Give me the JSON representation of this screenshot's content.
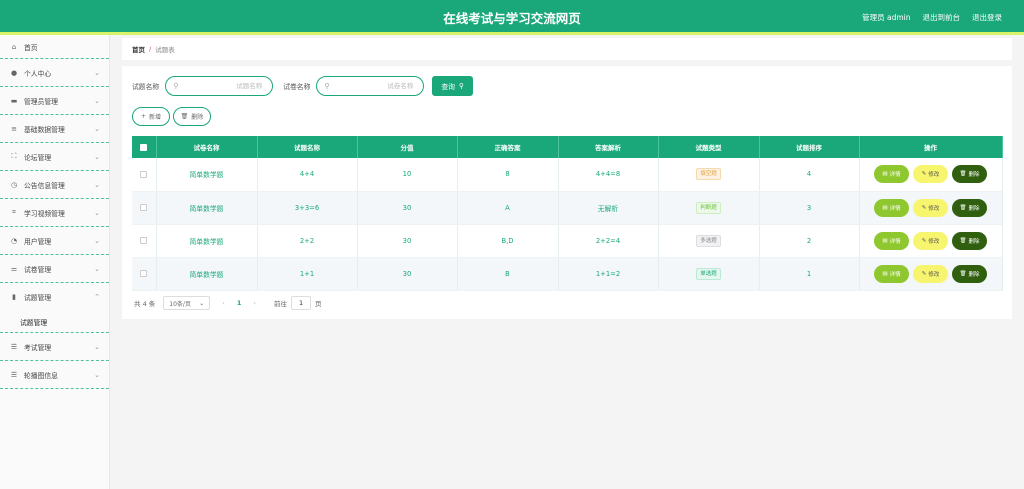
{
  "header": {
    "title": "在线考试与学习交流网页",
    "user_label": "管理员 admin",
    "exit_front": "退出到前台",
    "logout": "退出登录"
  },
  "sidebar": {
    "home": "首页",
    "items": [
      {
        "label": "个人中心",
        "icon": "user-icon"
      },
      {
        "label": "管理员管理",
        "icon": "monitor-icon"
      },
      {
        "label": "基础数据管理",
        "icon": "database-icon"
      },
      {
        "label": "论坛管理",
        "icon": "frame-icon"
      },
      {
        "label": "公告信息管理",
        "icon": "clock-icon"
      },
      {
        "label": "学习视频管理",
        "icon": "crop-icon"
      },
      {
        "label": "用户管理",
        "icon": "dashboard-icon"
      },
      {
        "label": "试卷管理",
        "icon": "sliders-icon"
      },
      {
        "label": "试题管理",
        "icon": "bar-chart-icon"
      }
    ],
    "sub_item": "试题管理",
    "items_after": [
      {
        "label": "考试管理",
        "icon": "list-icon"
      },
      {
        "label": "轮播图信息",
        "icon": "list-icon"
      }
    ]
  },
  "breadcrumb": {
    "home": "首页",
    "separator": "/",
    "current": "试题表"
  },
  "search": {
    "question_label": "试题名称",
    "question_placeholder": "试题名称",
    "paper_label": "试卷名称",
    "paper_placeholder": "试卷名称",
    "query_button": "查询"
  },
  "actions": {
    "add": "新增",
    "delete": "删除"
  },
  "table": {
    "columns": [
      "试卷名称",
      "试题名称",
      "分值",
      "正确答案",
      "答案解析",
      "试题类型",
      "试题排序",
      "操作"
    ],
    "rows": [
      {
        "paper": "简单数学题",
        "question": "4+4",
        "score": "10",
        "answer": "8",
        "analysis": "4+4=8",
        "type": "填空题",
        "order": "4"
      },
      {
        "paper": "简单数学题",
        "question": "3+3=6",
        "score": "30",
        "answer": "A",
        "analysis": "无解析",
        "type": "判断题",
        "order": "3"
      },
      {
        "paper": "简单数学题",
        "question": "2+2",
        "score": "30",
        "answer": "B,D",
        "analysis": "2+2=4",
        "type": "多选题",
        "order": "2"
      },
      {
        "paper": "简单数学题",
        "question": "1+1",
        "score": "30",
        "answer": "B",
        "analysis": "1+1=2",
        "type": "单选题",
        "order": "1"
      }
    ],
    "row_actions": {
      "detail": "详情",
      "edit": "修改",
      "delete": "删除"
    }
  },
  "pagination": {
    "total": "共 4 条",
    "page_size": "10条/页",
    "current_page": "1",
    "goto_label": "前往",
    "goto_value": "1",
    "page_suffix": "页"
  },
  "colors": {
    "brand": "#1aa87a",
    "stripe": "#d8f36a",
    "detail_button": "#8fc72e",
    "edit_button": "#f7f56e",
    "delete_button": "#2f5f0f"
  }
}
